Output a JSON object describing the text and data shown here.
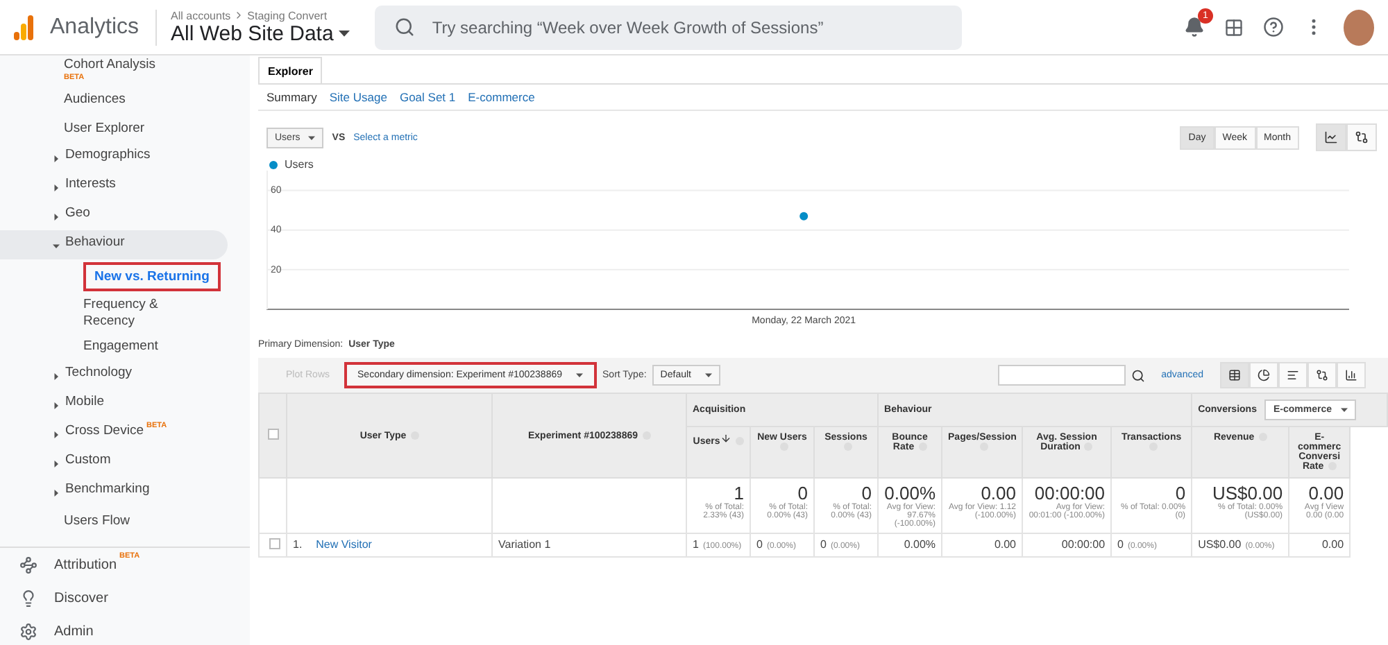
{
  "header": {
    "product": "Analytics",
    "breadcrumb": [
      "All accounts",
      "Staging Convert"
    ],
    "property": "All Web Site Data",
    "search": {
      "placeholder": "Try searching “Week over Week Growth of Sessions”"
    },
    "notification_count": "1"
  },
  "sidebar": {
    "items": [
      {
        "label": "Cohort Analysis",
        "badge": "BETA",
        "badge_below": true,
        "selected": false,
        "highlighted": false
      },
      {
        "label": "Audiences",
        "selected": false,
        "highlighted": false
      },
      {
        "label": "User Explorer",
        "selected": false,
        "highlighted": false
      },
      {
        "label": "Demographics",
        "expanded": false,
        "selected": false,
        "highlighted": false
      },
      {
        "label": "Interests",
        "expanded": false,
        "selected": false,
        "highlighted": false
      },
      {
        "label": "Geo",
        "expanded": false,
        "selected": false,
        "highlighted": false
      },
      {
        "label": "Behaviour",
        "expanded": true,
        "selected": false,
        "highlighted": false,
        "children": [
          {
            "label": "New vs. Returning",
            "selected": true,
            "highlighted": true
          },
          {
            "label": "Frequency & Recency",
            "selected": false,
            "highlighted": false
          },
          {
            "label": "Engagement",
            "selected": false,
            "highlighted": false
          }
        ]
      },
      {
        "label": "Technology",
        "expanded": false,
        "selected": false,
        "highlighted": false
      },
      {
        "label": "Mobile",
        "expanded": false,
        "selected": false,
        "highlighted": false
      },
      {
        "label": "Cross Device",
        "badge": "BETA",
        "badge_below": false,
        "expanded": false,
        "selected": false,
        "highlighted": false
      },
      {
        "label": "Custom",
        "expanded": false,
        "selected": false,
        "highlighted": false
      },
      {
        "label": "Benchmarking",
        "expanded": false,
        "selected": false,
        "highlighted": false
      },
      {
        "label": "Users Flow",
        "selected": false,
        "highlighted": false
      }
    ],
    "bottom": [
      {
        "label": "Attribution",
        "badge": "BETA"
      },
      {
        "label": "Discover"
      },
      {
        "label": "Admin"
      }
    ]
  },
  "explorer": {
    "tabs": [
      {
        "label": "Explorer",
        "selected": true
      }
    ],
    "subtabs": [
      {
        "label": "Summary",
        "selected": true
      },
      {
        "label": "Site Usage",
        "selected": false
      },
      {
        "label": "Goal Set 1",
        "selected": false
      },
      {
        "label": "E-commerce",
        "selected": false
      }
    ],
    "metric": "Users",
    "vs": "VS",
    "select_metric": "Select a metric",
    "periods": [
      {
        "label": "Day",
        "selected": true
      },
      {
        "label": "Week",
        "selected": false
      },
      {
        "label": "Month",
        "selected": false
      }
    ],
    "chart_views": [
      {
        "selected": true
      },
      {
        "selected": false
      }
    ],
    "chart_data": {
      "type": "scatter",
      "categories": [
        "Monday, 22 March 2021"
      ],
      "series": [
        {
          "name": "Users",
          "color": "#058dc7",
          "values": [
            47
          ]
        }
      ],
      "ylim": [
        0,
        70
      ],
      "yticks": [
        20,
        40,
        60
      ],
      "grid": true
    }
  },
  "table": {
    "primary_dimension_label": "Primary Dimension:",
    "primary_dimension": "User Type",
    "plot_rows": {
      "label": "Plot Rows",
      "disabled": true
    },
    "secondary_dimension": {
      "label": "Secondary dimension: Experiment #100238869",
      "highlighted": true
    },
    "sort_type_label": "Sort Type:",
    "sort_type": "Default",
    "advanced": "advanced",
    "views": [
      {
        "selected": true
      },
      {
        "selected": false
      },
      {
        "selected": false
      },
      {
        "selected": false
      },
      {
        "selected": false
      }
    ],
    "groups": [
      {
        "label": "Acquisition"
      },
      {
        "label": "Behaviour"
      },
      {
        "label": "Conversions",
        "select": "E-commerce"
      }
    ],
    "header_checked": false,
    "dimension_columns": [
      "User Type",
      "Experiment #100238869"
    ],
    "columns": [
      {
        "label": "Users",
        "sorted": true
      },
      {
        "label": "New Users",
        "sorted": false
      },
      {
        "label": "Sessions",
        "sorted": false
      },
      {
        "label": "Bounce Rate",
        "sorted": false
      },
      {
        "label": "Pages/Session",
        "sorted": false
      },
      {
        "label": "Avg. Session Duration",
        "sorted": false
      },
      {
        "label": "Transactions",
        "sorted": false
      },
      {
        "label": "Revenue",
        "sorted": false
      },
      {
        "label": "E-commerc Conversi Rate",
        "sorted": false
      }
    ],
    "totals": [
      {
        "value": "1",
        "note": "% of Total: 2.33% (43)"
      },
      {
        "value": "0",
        "note": "% of Total: 0.00% (43)"
      },
      {
        "value": "0",
        "note": "% of Total: 0.00% (43)"
      },
      {
        "value": "0.00%",
        "note": "Avg for View: 97.67% (-100.00%)"
      },
      {
        "value": "0.00",
        "note": "Avg for View: 1.12 (-100.00%)"
      },
      {
        "value": "00:00:00",
        "note": "Avg for View: 00:01:00 (-100.00%)"
      },
      {
        "value": "0",
        "note": "% of Total: 0.00% (0)"
      },
      {
        "value": "US$0.00",
        "note": "% of Total: 0.00% (US$0.00)"
      },
      {
        "value": "0.00",
        "note": "Avg f View 0.00 (0.00"
      }
    ],
    "rows": [
      {
        "index": "1.",
        "user_type": "New Visitor",
        "experiment": "Variation 1",
        "checked": false,
        "cells": [
          {
            "value": "1",
            "pct": "(100.00%)"
          },
          {
            "value": "0",
            "pct": "(0.00%)"
          },
          {
            "value": "0",
            "pct": "(0.00%)"
          },
          {
            "value": "0.00%"
          },
          {
            "value": "0.00"
          },
          {
            "value": "00:00:00"
          },
          {
            "value": "0",
            "pct": "(0.00%)"
          },
          {
            "value": "US$0.00",
            "pct": "(0.00%)"
          },
          {
            "value": "0.00"
          }
        ]
      }
    ]
  }
}
